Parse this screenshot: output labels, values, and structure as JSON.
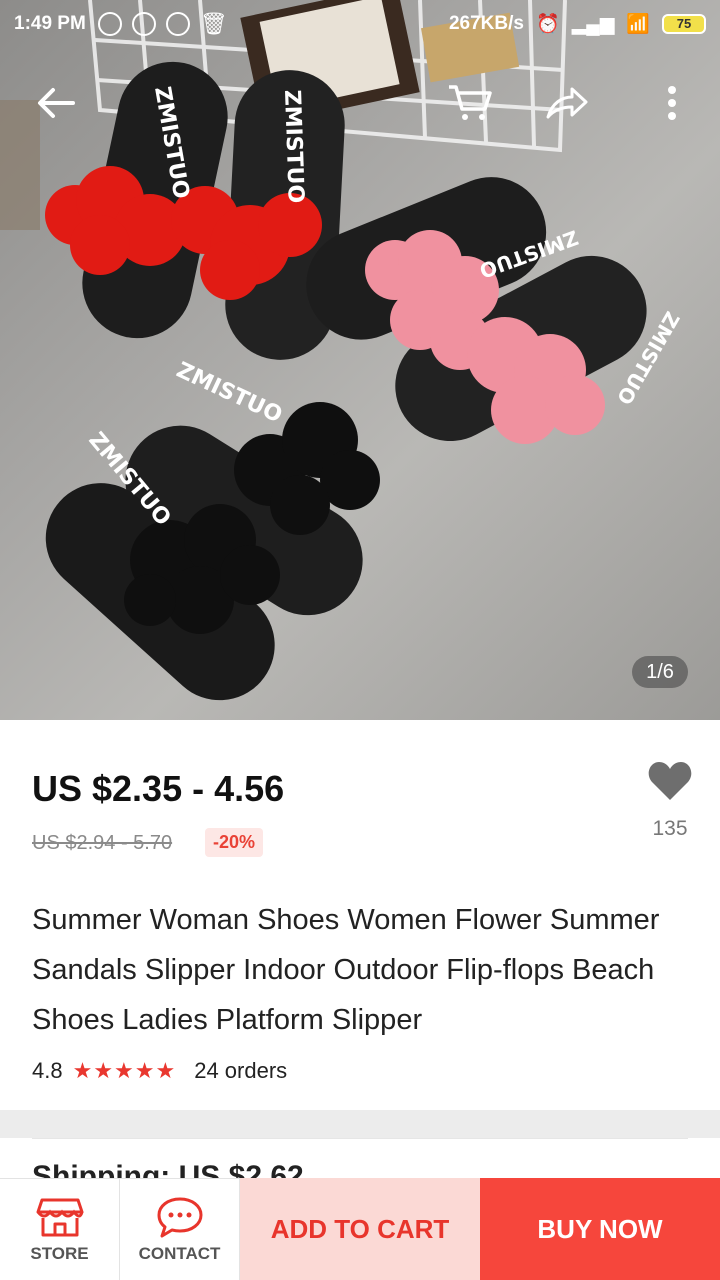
{
  "status_bar": {
    "time": "1:49 PM",
    "speed": "267KB/s",
    "battery": "75"
  },
  "toolbar": {
    "icons": [
      "back-arrow-icon",
      "cart-icon",
      "share-icon",
      "more-vert-icon"
    ]
  },
  "gallery": {
    "pager": "1/6",
    "brand_print": "ZMISTUO"
  },
  "product": {
    "price": "US $2.35 - 4.56",
    "original_price": "US $2.94 - 5.70",
    "discount": "-20%",
    "wishlist_count": "135",
    "title": "Summer Woman Shoes Women Flower Summer Sandals Slipper Indoor Outdoor Flip-flops Beach Shoes Ladies Platform Slipper",
    "rating": "4.8",
    "stars": "★★★★★",
    "orders": "24 orders"
  },
  "shipping": {
    "label": "Shipping: US $2.62"
  },
  "bottom_bar": {
    "store_label": "STORE",
    "contact_label": "CONTACT",
    "add_to_cart": "ADD TO CART",
    "buy_now": "BUY NOW"
  },
  "colors": {
    "accent": "#f6463c",
    "accent_light": "#fbd9d5",
    "star": "#e9372f"
  }
}
